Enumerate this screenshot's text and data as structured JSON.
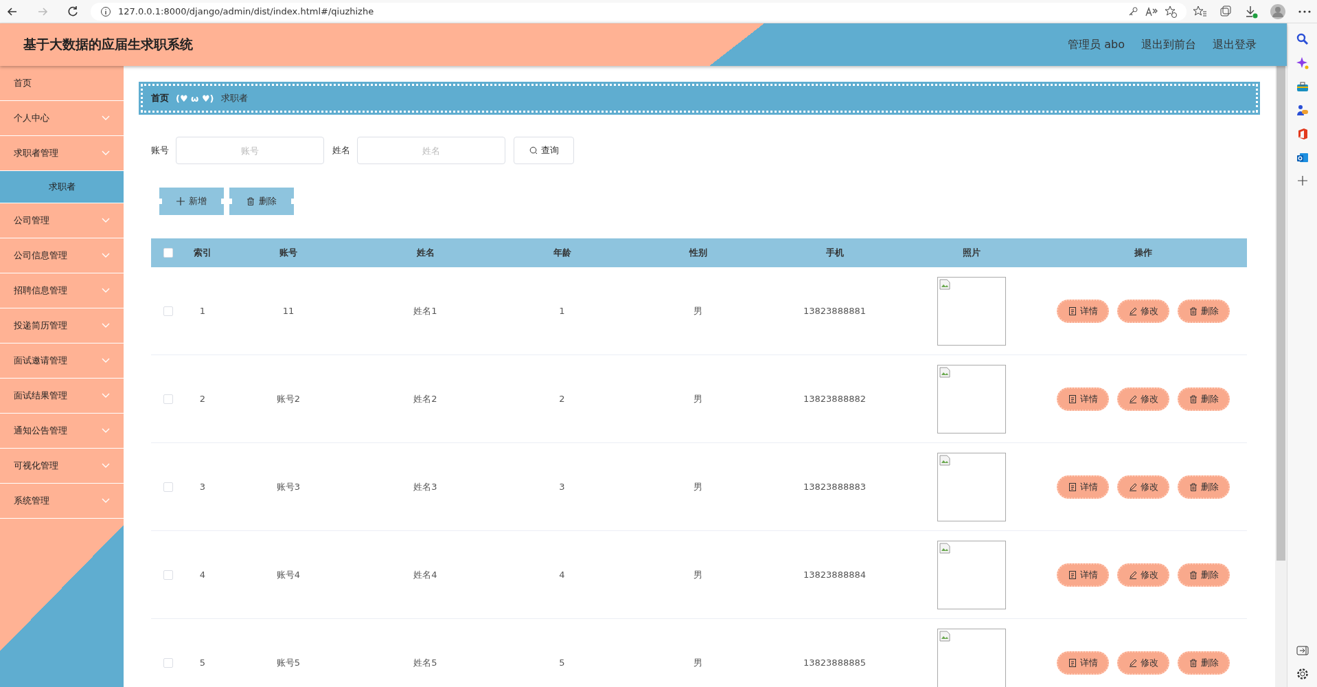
{
  "browser": {
    "url": "127.0.0.1:8000/django/admin/dist/index.html#/qiuzhizhe"
  },
  "header": {
    "title": "基于大数据的应届生求职系统",
    "links": [
      "管理员 abo",
      "退出到前台",
      "退出登录"
    ]
  },
  "sidebar": {
    "items": [
      {
        "label": "首页",
        "kind": "link"
      },
      {
        "label": "个人中心",
        "kind": "menu"
      },
      {
        "label": "求职者管理",
        "kind": "menu",
        "children": [
          {
            "label": "求职者",
            "selected": true
          }
        ]
      },
      {
        "label": "公司管理",
        "kind": "menu"
      },
      {
        "label": "公司信息管理",
        "kind": "menu"
      },
      {
        "label": "招聘信息管理",
        "kind": "menu"
      },
      {
        "label": "投递简历管理",
        "kind": "menu"
      },
      {
        "label": "面试邀请管理",
        "kind": "menu"
      },
      {
        "label": "面试结果管理",
        "kind": "menu"
      },
      {
        "label": "通知公告管理",
        "kind": "menu"
      },
      {
        "label": "可视化管理",
        "kind": "menu"
      },
      {
        "label": "系统管理",
        "kind": "menu"
      }
    ]
  },
  "breadcrumb": {
    "home": "首页",
    "separator": "(♥ ω ♥)",
    "current": "求职者"
  },
  "search": {
    "fields": [
      {
        "label": "账号",
        "placeholder": "账号"
      },
      {
        "label": "姓名",
        "placeholder": "姓名"
      }
    ],
    "button": "查询"
  },
  "actions": [
    {
      "kind": "add",
      "label": "新增"
    },
    {
      "kind": "delete",
      "label": "删除"
    }
  ],
  "table": {
    "select_all": false,
    "columns": [
      "索引",
      "账号",
      "姓名",
      "年龄",
      "性别",
      "手机",
      "照片",
      "操作"
    ],
    "rows": [
      {
        "checked": false,
        "index": "1",
        "account": "11",
        "name": "姓名1",
        "age": "1",
        "gender": "男",
        "phone": "13823888881",
        "actions": [
          "详情",
          "修改",
          "删除"
        ]
      },
      {
        "checked": false,
        "index": "2",
        "account": "账号2",
        "name": "姓名2",
        "age": "2",
        "gender": "男",
        "phone": "13823888882",
        "actions": [
          "详情",
          "修改",
          "删除"
        ]
      },
      {
        "checked": false,
        "index": "3",
        "account": "账号3",
        "name": "姓名3",
        "age": "3",
        "gender": "男",
        "phone": "13823888883",
        "actions": [
          "详情",
          "修改",
          "删除"
        ]
      },
      {
        "checked": false,
        "index": "4",
        "account": "账号4",
        "name": "姓名4",
        "age": "4",
        "gender": "男",
        "phone": "13823888884",
        "actions": [
          "详情",
          "修改",
          "删除"
        ]
      },
      {
        "checked": false,
        "index": "5",
        "account": "账号5",
        "name": "姓名5",
        "age": "5",
        "gender": "男",
        "phone": "13823888885",
        "actions": [
          "详情",
          "修改",
          "删除"
        ]
      }
    ]
  }
}
